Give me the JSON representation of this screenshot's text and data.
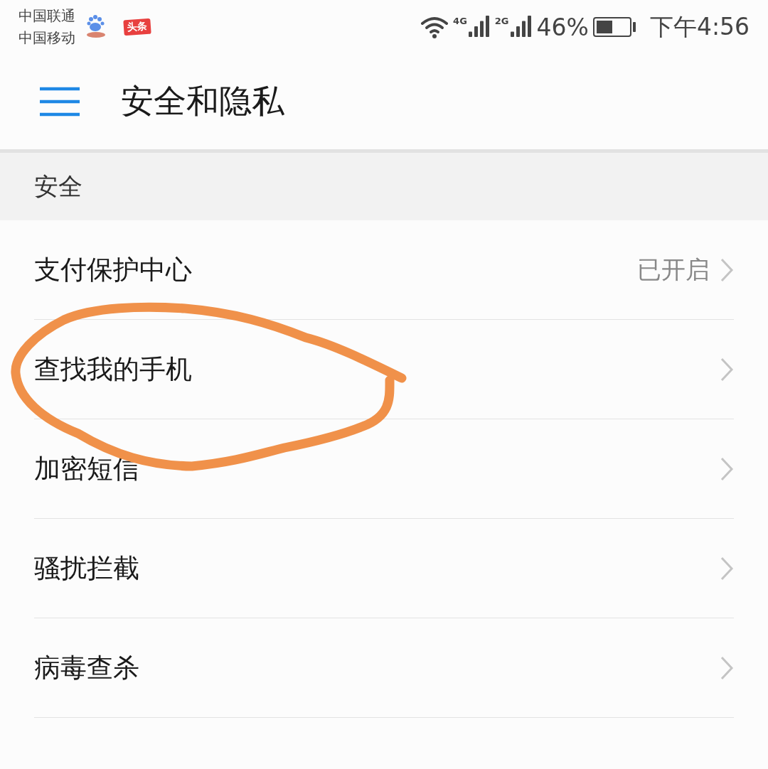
{
  "status_bar": {
    "carriers": [
      "中国联通",
      "中国移动"
    ],
    "notification_badge": "头条",
    "network_1": "4G",
    "network_2": "2G",
    "battery": "46%",
    "time": "下午4:56"
  },
  "header": {
    "title": "安全和隐私"
  },
  "section": {
    "title": "安全"
  },
  "rows": [
    {
      "label": "支付保护中心",
      "value": "已开启"
    },
    {
      "label": "查找我的手机"
    },
    {
      "label": "加密短信"
    },
    {
      "label": "骚扰拦截"
    },
    {
      "label": "病毒查杀"
    }
  ],
  "annotation": {
    "kind": "hand-drawn-circle",
    "color": "#f0914a"
  }
}
